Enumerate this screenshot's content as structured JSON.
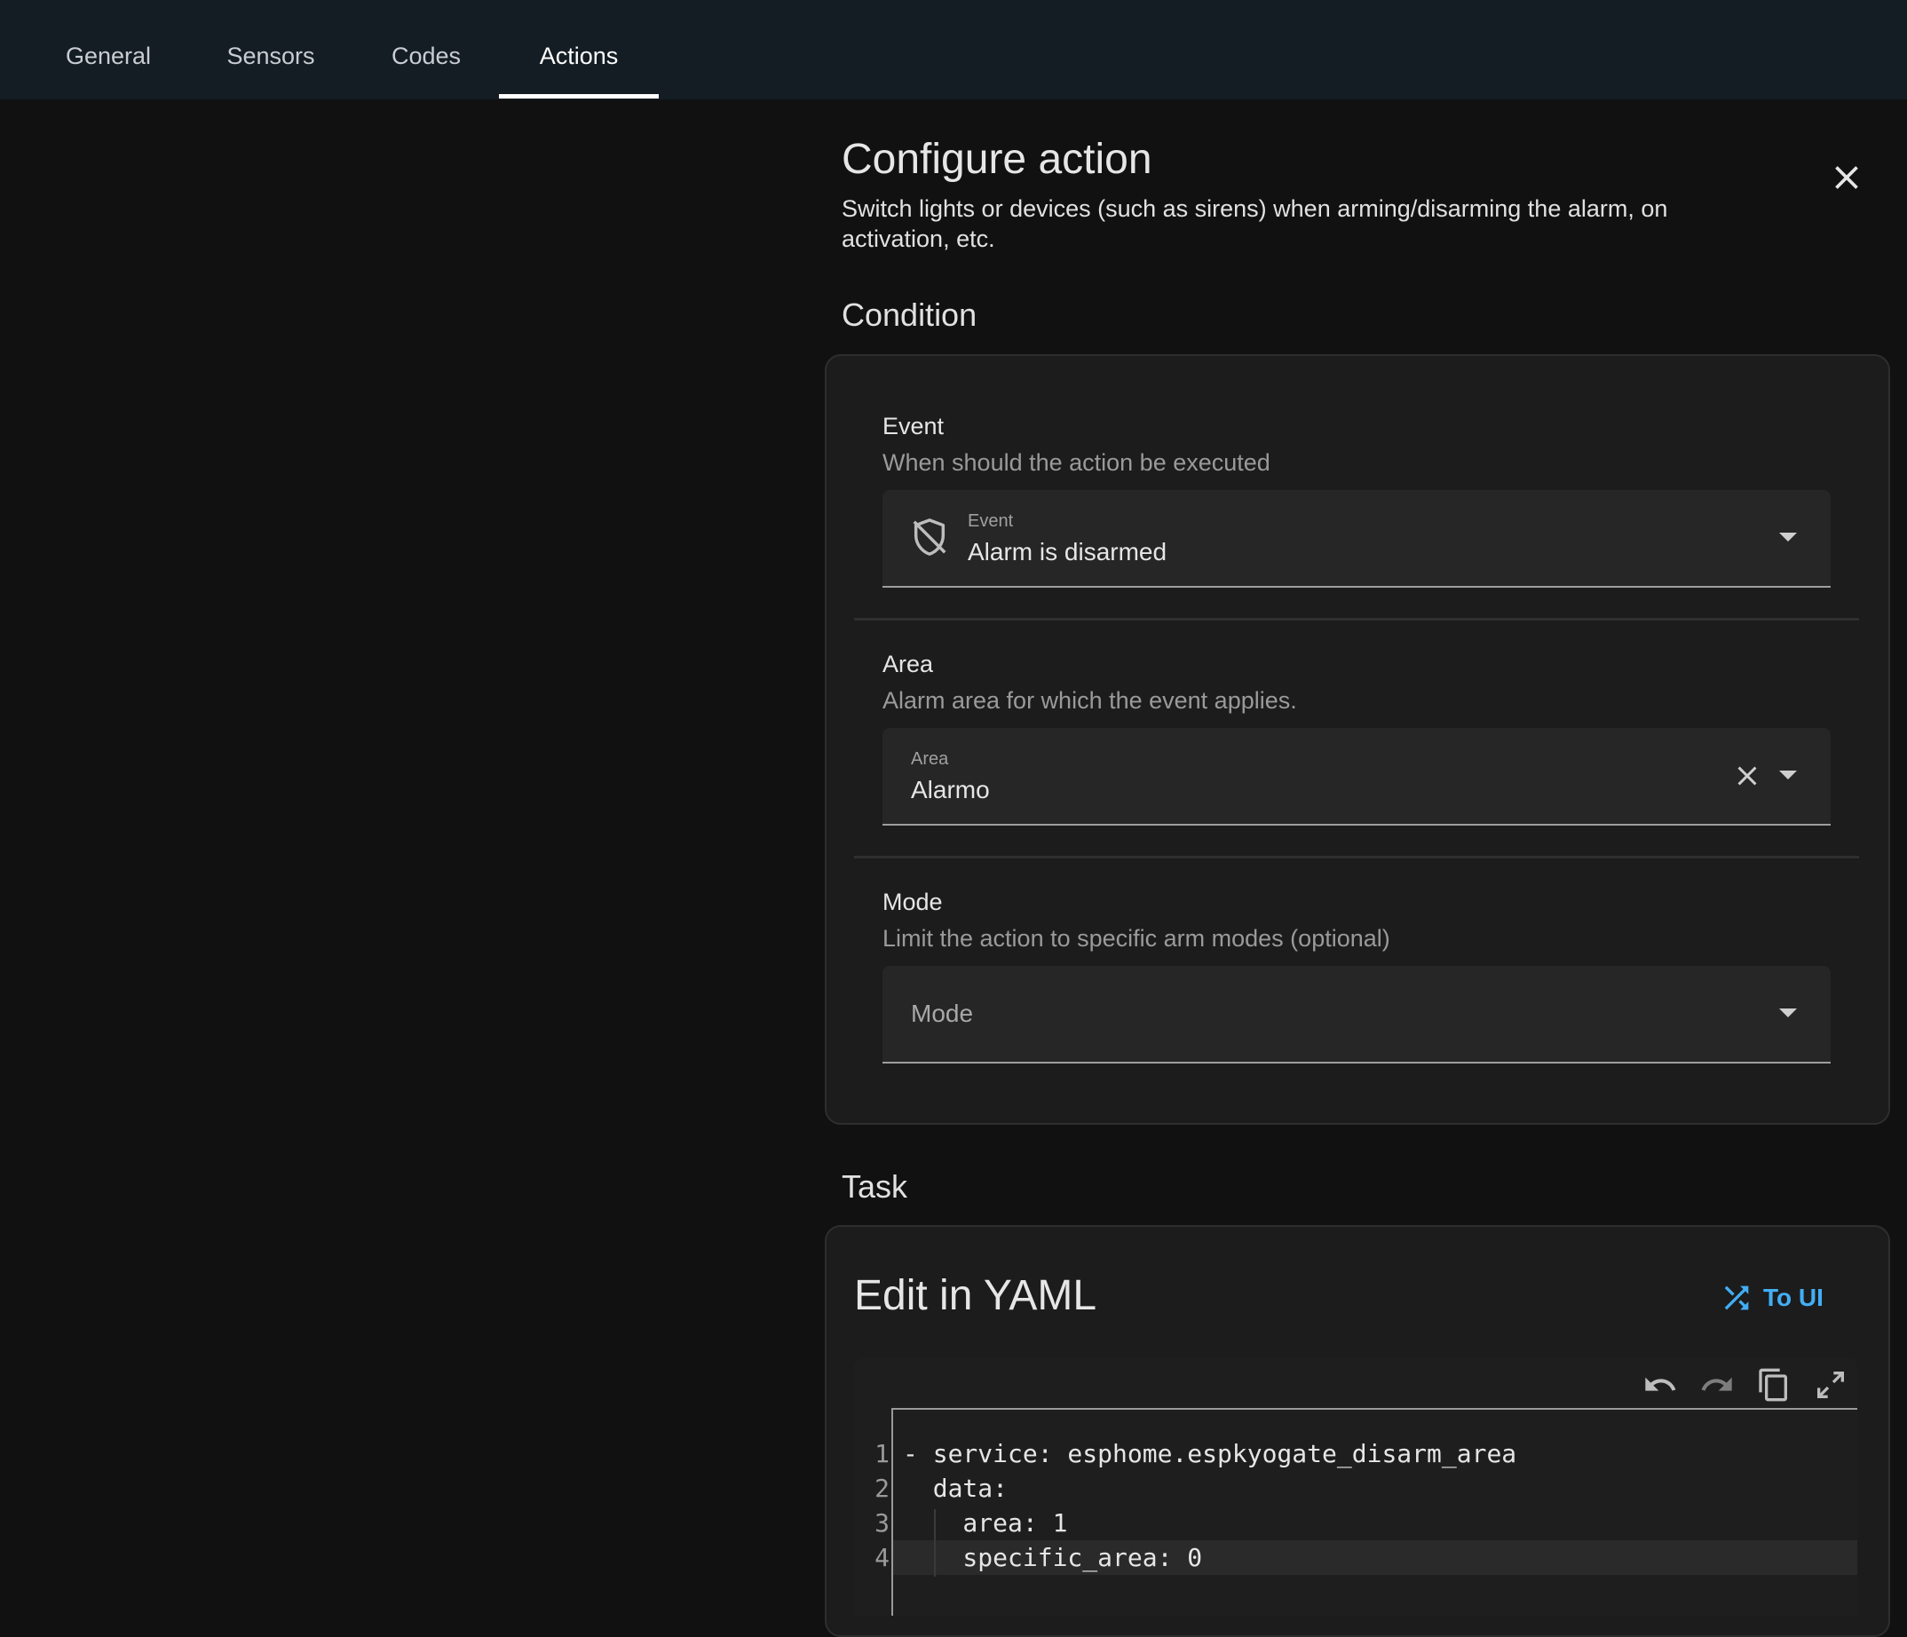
{
  "tabs": [
    {
      "label": "General"
    },
    {
      "label": "Sensors"
    },
    {
      "label": "Codes"
    },
    {
      "label": "Actions",
      "active": true
    }
  ],
  "dialog": {
    "title": "Configure action",
    "description": "Switch lights or devices (such as sirens) when arming/disarming the alarm, on activation, etc.",
    "close_icon": "close-icon"
  },
  "condition": {
    "heading": "Condition",
    "event": {
      "label": "Event",
      "help": "When should the action be executed",
      "select_label": "Event",
      "value": "Alarm is disarmed",
      "icon": "shield-off-icon"
    },
    "area": {
      "label": "Area",
      "help": "Alarm area for which the event applies.",
      "select_label": "Area",
      "value": "Alarmo"
    },
    "mode": {
      "label": "Mode",
      "help": "Limit the action to specific arm modes (optional)",
      "placeholder": "Mode"
    }
  },
  "task": {
    "heading": "Task",
    "yaml_title": "Edit in YAML",
    "to_ui_label": "To UI",
    "toolbar_icons": [
      "undo-icon",
      "redo-icon",
      "copy-icon",
      "fullscreen-icon"
    ],
    "code_lines": [
      {
        "num": "1",
        "text": "- service: esphome.espkyogate_disarm_area"
      },
      {
        "num": "2",
        "text": "  data:"
      },
      {
        "num": "3",
        "text": "    area: 1"
      },
      {
        "num": "4",
        "text": "    specific_area: 0"
      }
    ]
  },
  "colors": {
    "accent": "#42aef5",
    "background": "#111111",
    "tabbar": "#141d24",
    "card": "#1c1c1c"
  }
}
